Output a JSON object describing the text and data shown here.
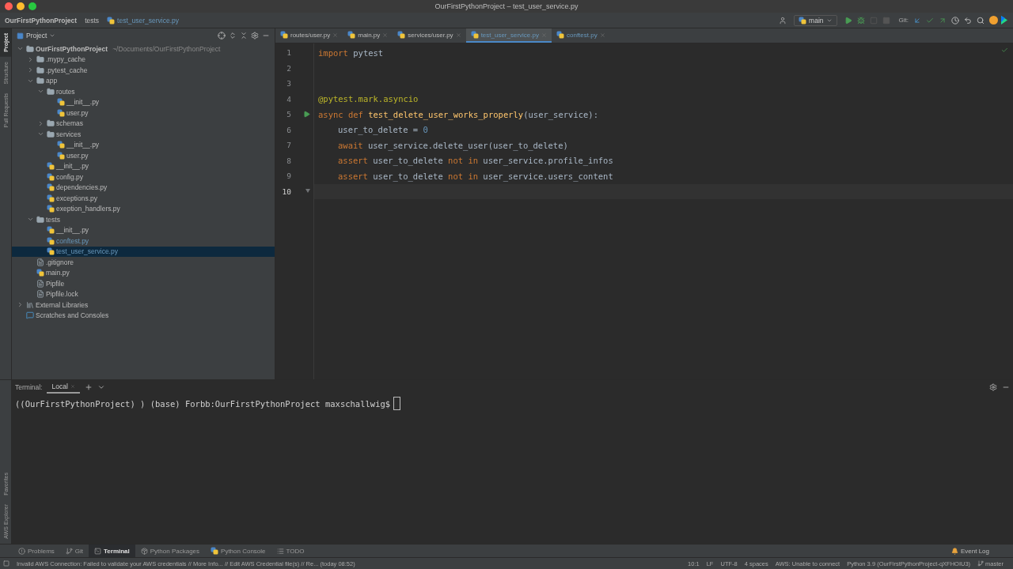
{
  "window": {
    "title": "OurFirstPythonProject – test_user_service.py"
  },
  "breadcrumbs": [
    {
      "kind": "project",
      "text": "OurFirstPythonProject"
    },
    {
      "kind": "folder",
      "text": "tests"
    },
    {
      "kind": "python",
      "text": "test_user_service.py"
    }
  ],
  "toolbar": {
    "run_config": "main",
    "git_label": "Git:"
  },
  "side_tabs_top": [
    {
      "label": "Project",
      "selected": true
    },
    {
      "label": "Structure",
      "selected": false
    },
    {
      "label": "Pull Requests",
      "selected": false
    }
  ],
  "side_tabs_bottom": [
    {
      "label": "Favorites"
    },
    {
      "label": "AWS Explorer"
    }
  ],
  "project_panel": {
    "title": "Project",
    "tree": [
      {
        "kind": "project",
        "name": "OurFirstPythonProject",
        "path": "~/Documents/OurFirstPythonProject",
        "expanded": true,
        "selected": false,
        "changed": false,
        "children": [
          {
            "kind": "folder",
            "name": ".mypy_cache",
            "expanded": false,
            "selected": false,
            "changed": false
          },
          {
            "kind": "folder",
            "name": ".pytest_cache",
            "expanded": false,
            "selected": false,
            "changed": false
          },
          {
            "kind": "folder",
            "name": "app",
            "expanded": true,
            "selected": false,
            "changed": false,
            "children": [
              {
                "kind": "folder",
                "name": "routes",
                "expanded": true,
                "selected": false,
                "changed": false,
                "children": [
                  {
                    "kind": "python",
                    "name": "__init__.py",
                    "selected": false,
                    "changed": false
                  },
                  {
                    "kind": "python",
                    "name": "user.py",
                    "selected": false,
                    "changed": false
                  }
                ]
              },
              {
                "kind": "folder",
                "name": "schemas",
                "expanded": false,
                "selected": false,
                "changed": false
              },
              {
                "kind": "folder",
                "name": "services",
                "expanded": true,
                "selected": false,
                "changed": false,
                "children": [
                  {
                    "kind": "python",
                    "name": "__init__.py",
                    "selected": false,
                    "changed": false
                  },
                  {
                    "kind": "python",
                    "name": "user.py",
                    "selected": false,
                    "changed": false
                  }
                ]
              },
              {
                "kind": "python",
                "name": "__init__.py",
                "selected": false,
                "changed": false
              },
              {
                "kind": "python",
                "name": "config.py",
                "selected": false,
                "changed": false
              },
              {
                "kind": "python",
                "name": "dependencies.py",
                "selected": false,
                "changed": false
              },
              {
                "kind": "python",
                "name": "exceptions.py",
                "selected": false,
                "changed": false
              },
              {
                "kind": "python",
                "name": "exeption_handlers.py",
                "selected": false,
                "changed": false
              }
            ]
          },
          {
            "kind": "folder",
            "name": "tests",
            "expanded": true,
            "selected": false,
            "changed": false,
            "children": [
              {
                "kind": "python",
                "name": "__init__.py",
                "selected": false,
                "changed": false
              },
              {
                "kind": "python",
                "name": "conftest.py",
                "selected": false,
                "changed": true
              },
              {
                "kind": "python",
                "name": "test_user_service.py",
                "selected": true,
                "changed": true
              }
            ]
          },
          {
            "kind": "file",
            "name": ".gitignore",
            "selected": false,
            "changed": false
          },
          {
            "kind": "python",
            "name": "main.py",
            "selected": false,
            "changed": false
          },
          {
            "kind": "file",
            "name": "Pipfile",
            "selected": false,
            "changed": false
          },
          {
            "kind": "file",
            "name": "Pipfile.lock",
            "selected": false,
            "changed": false
          }
        ]
      },
      {
        "kind": "library",
        "name": "External Libraries",
        "expanded": false,
        "selected": false,
        "changed": false
      },
      {
        "kind": "scratches",
        "name": "Scratches and Consoles",
        "selected": false,
        "changed": false
      }
    ]
  },
  "editor_tabs": [
    {
      "label": "routes/user.py",
      "selected": false,
      "changed": false
    },
    {
      "label": "main.py",
      "selected": false,
      "changed": false
    },
    {
      "label": "services/user.py",
      "selected": false,
      "changed": false
    },
    {
      "label": "test_user_service.py",
      "selected": true,
      "changed": true
    },
    {
      "label": "conftest.py",
      "selected": false,
      "changed": true
    }
  ],
  "code_lines": [
    {
      "number": "1",
      "current": false,
      "indented": false,
      "runnable": false,
      "fold_marker": false,
      "tokens": [
        {
          "kind": "keyword",
          "text": "import"
        },
        {
          "kind": "plain",
          "text": " pytest"
        }
      ]
    },
    {
      "number": "2",
      "current": false,
      "runnable": false,
      "fold_marker": false
    },
    {
      "number": "3",
      "current": false,
      "runnable": false,
      "fold_marker": false
    },
    {
      "number": "4",
      "current": false,
      "indented": false,
      "runnable": false,
      "fold_marker": false,
      "tokens": [
        {
          "kind": "decorator",
          "text": "@pytest.mark.asyncio"
        }
      ]
    },
    {
      "number": "5",
      "current": false,
      "indented": false,
      "runnable": true,
      "fold_marker": false,
      "tokens": [
        {
          "kind": "keyword",
          "text": "async def "
        },
        {
          "kind": "function",
          "text": "test_delete_user_works_properly"
        },
        {
          "kind": "plain",
          "text": "(user_service):"
        }
      ]
    },
    {
      "number": "6",
      "current": false,
      "indented": true,
      "runnable": false,
      "fold_marker": false,
      "tokens": [
        {
          "kind": "plain",
          "text": "user_to_delete = "
        },
        {
          "kind": "number",
          "text": "0"
        }
      ]
    },
    {
      "number": "7",
      "current": false,
      "indented": true,
      "runnable": false,
      "fold_marker": false,
      "tokens": [
        {
          "kind": "keyword",
          "text": "await"
        },
        {
          "kind": "plain",
          "text": " user_service.delete_user(user_to_delete)"
        }
      ]
    },
    {
      "number": "8",
      "current": false,
      "indented": true,
      "runnable": false,
      "fold_marker": false,
      "tokens": [
        {
          "kind": "keyword",
          "text": "assert"
        },
        {
          "kind": "plain",
          "text": " user_to_delete "
        },
        {
          "kind": "keyword",
          "text": "not in"
        },
        {
          "kind": "plain",
          "text": " user_service.profile_infos"
        }
      ]
    },
    {
      "number": "9",
      "current": false,
      "indented": true,
      "runnable": false,
      "fold_marker": false,
      "tokens": [
        {
          "kind": "keyword",
          "text": "assert"
        },
        {
          "kind": "plain",
          "text": " user_to_delete "
        },
        {
          "kind": "keyword",
          "text": "not in"
        },
        {
          "kind": "plain",
          "text": " user_service.users_content"
        }
      ]
    },
    {
      "number": "10",
      "current": true,
      "runnable": false,
      "fold_marker": true
    }
  ],
  "terminal": {
    "label": "Terminal:",
    "tabs": [
      {
        "label": "Local",
        "selected": true
      }
    ],
    "lines": [
      "((OurFirstPythonProject) ) (base) Forbb:OurFirstPythonProject maxschallwig$"
    ]
  },
  "tool_tabs": [
    {
      "kind": "problems",
      "label": "Problems",
      "selected": false
    },
    {
      "kind": "git",
      "label": "Git",
      "selected": false
    },
    {
      "kind": "terminal",
      "label": "Terminal",
      "selected": true
    },
    {
      "kind": "packages",
      "label": "Python Packages",
      "selected": false
    },
    {
      "kind": "console",
      "label": "Python Console",
      "selected": false
    },
    {
      "kind": "todo",
      "label": "TODO",
      "selected": false
    }
  ],
  "event_log": "Event Log",
  "status_bar": {
    "message": "Invalid AWS Connection: Failed to validate your AWS credentials // More Info... // Edit AWS Credential file(s) // Re... (today 08:52)",
    "items": [
      "10:1",
      "LF",
      "UTF-8",
      "4 spaces",
      "AWS: Unable to connect",
      "Python 3.9 (OurFirstPythonProject-qXFHOIU3)"
    ],
    "branch": "master"
  }
}
